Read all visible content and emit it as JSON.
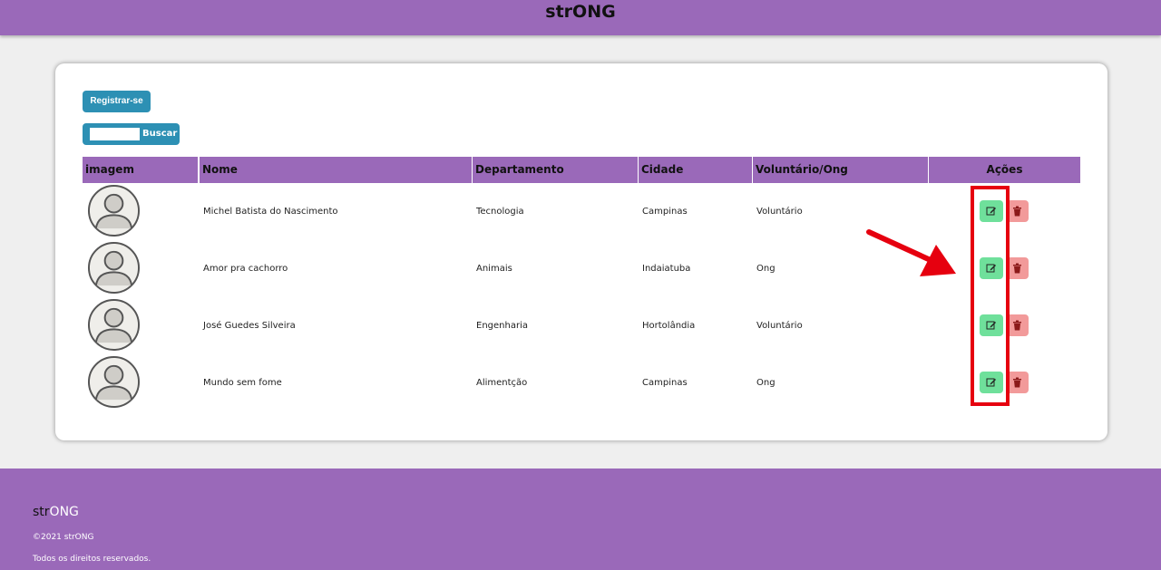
{
  "header": {
    "title": "strONG"
  },
  "actions": {
    "register_label": "Registrar-se",
    "search_label": "Buscar",
    "search_value": ""
  },
  "table": {
    "columns": [
      "imagem",
      "Nome",
      "Departamento",
      "Cidade",
      "Voluntário/Ong",
      "Ações"
    ],
    "rows": [
      {
        "nome": "Michel Batista do Nascimento",
        "departamento": "Tecnologia",
        "cidade": "Campinas",
        "tipo": "Voluntário"
      },
      {
        "nome": "Amor pra cachorro",
        "departamento": "Animais",
        "cidade": "Indaiatuba",
        "tipo": "Ong"
      },
      {
        "nome": "José Guedes Silveira",
        "departamento": "Engenharia",
        "cidade": "Hortolândia",
        "tipo": "Voluntário"
      },
      {
        "nome": "Mundo sem fome",
        "departamento": "Alimentção",
        "cidade": "Campinas",
        "tipo": "Ong"
      }
    ]
  },
  "footer": {
    "brand_prefix": "str",
    "brand_suffix": "ONG",
    "copyright": "©2021 strONG",
    "rights": "Todos os direitos reservados."
  },
  "colors": {
    "purple": "#9a69b9",
    "blue_button": "#2d90b4",
    "edit_green": "#6fe09b",
    "delete_red": "#f29a9a",
    "annotation_red": "#e6000f"
  },
  "icons": {
    "avatar": "user-avatar-icon",
    "edit": "edit-icon",
    "delete": "trash-icon",
    "annotation": "red-arrow"
  }
}
